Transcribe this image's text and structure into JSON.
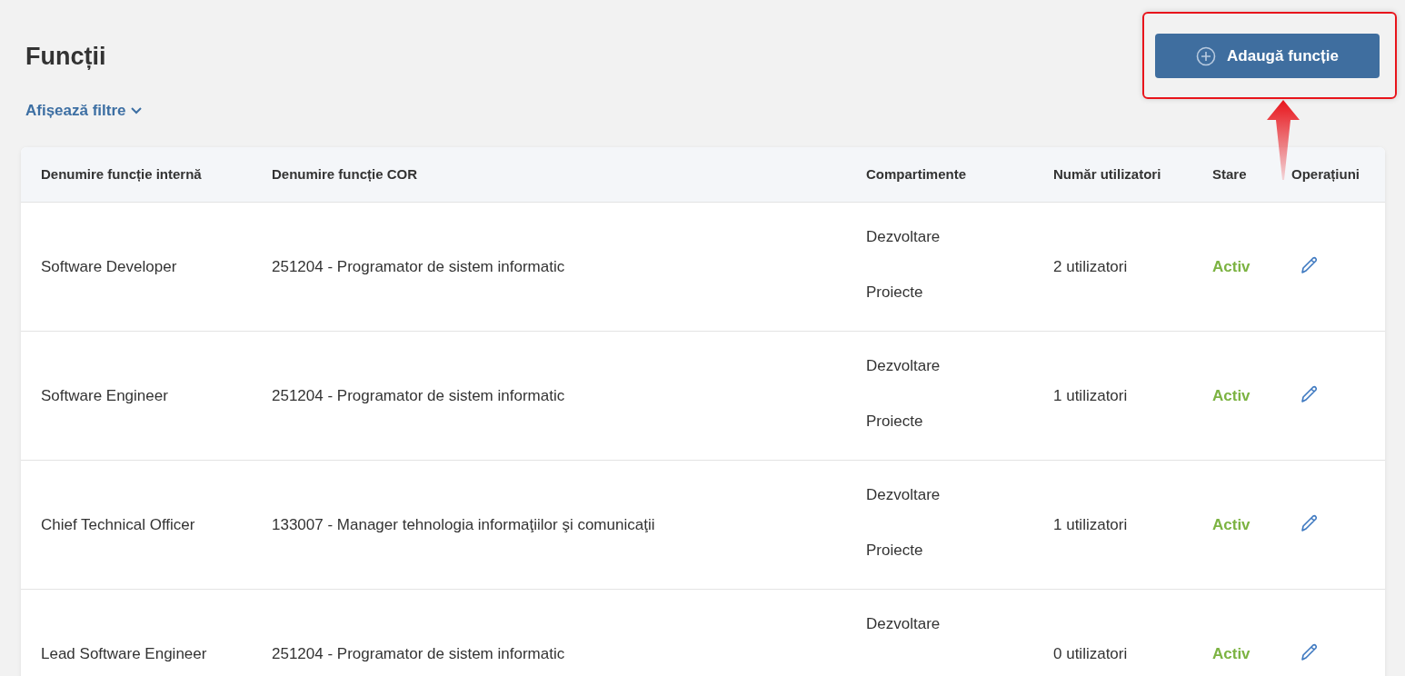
{
  "page": {
    "title": "Funcții",
    "filters_link": "Afișează filtre",
    "add_button": "Adaugă funcție"
  },
  "table": {
    "columns": [
      "Denumire funcție internă",
      "Denumire funcție COR",
      "Compartimente",
      "Număr utilizatori",
      "Stare",
      "Operațiuni"
    ],
    "rows": [
      {
        "internal_name": "Software Developer",
        "cor_name": "251204 - Programator de sistem informatic",
        "departments": [
          "Dezvoltare",
          "Proiecte"
        ],
        "users": "2 utilizatori",
        "status": "Activ"
      },
      {
        "internal_name": "Software Engineer",
        "cor_name": "251204 - Programator de sistem informatic",
        "departments": [
          "Dezvoltare",
          "Proiecte"
        ],
        "users": "1 utilizatori",
        "status": "Activ"
      },
      {
        "internal_name": "Chief Technical Officer",
        "cor_name": "133007 - Manager tehnologia informaţiilor şi comunicaţii",
        "departments": [
          "Dezvoltare",
          "Proiecte"
        ],
        "users": "1 utilizatori",
        "status": "Activ"
      },
      {
        "internal_name": "Lead Software Engineer",
        "cor_name": "251204 - Programator de sistem informatic",
        "departments": [
          "Dezvoltare"
        ],
        "users": "0 utilizatori",
        "status": "Activ"
      }
    ]
  }
}
